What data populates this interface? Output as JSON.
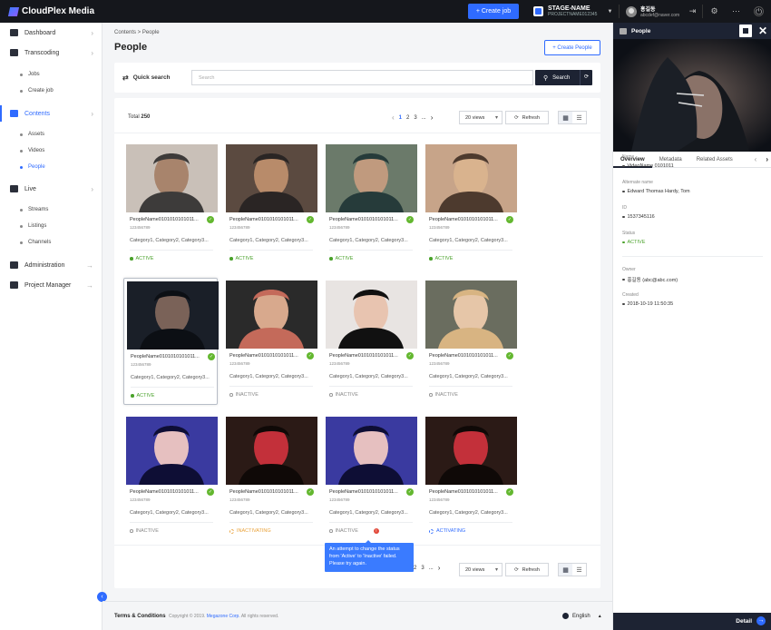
{
  "app": {
    "name": "CloudPlex Media",
    "create_job": "+ Create job"
  },
  "stage": {
    "name": "STAGE-NAME",
    "project": "PROJECTNAME012345"
  },
  "user": {
    "name": "홍길동",
    "email": "abcdef@naver.com"
  },
  "sidebar": {
    "dashboard": "Dashboard",
    "transcoding": "Transcoding",
    "jobs": "Jobs",
    "create_job": "Create job",
    "contents": "Contents",
    "assets": "Assets",
    "videos": "Videos",
    "people": "People",
    "live": "Live",
    "streams": "Streams",
    "listings": "Listings",
    "channels": "Channels",
    "administration": "Administration",
    "project_manager": "Project Manager"
  },
  "breadcrumb": "Contents > People",
  "page_title": "People",
  "create_people": "+ Create People",
  "quick_search": {
    "label": "Quick search",
    "placeholder": "Search",
    "button": "Search"
  },
  "list": {
    "total_label": "Total",
    "total": "250",
    "pages": [
      "1",
      "2",
      "3",
      "..."
    ],
    "per_page": "20 views",
    "refresh": "Refresh"
  },
  "cards": [
    {
      "name": "PeopleName0101010101011...",
      "code": "123456789",
      "cats": "Category1, Category2, Category3...",
      "status": "ACTIVE"
    },
    {
      "name": "PeopleName0101010101011...",
      "code": "123456789",
      "cats": "Category1, Category2, Category3...",
      "status": "ACTIVE"
    },
    {
      "name": "PeopleName0101010101011...",
      "code": "123456789",
      "cats": "Category1, Category2, Category3...",
      "status": "ACTIVE"
    },
    {
      "name": "PeopleName0101010101011...",
      "code": "123456789",
      "cats": "Category1, Category2, Category3...",
      "status": "ACTIVE"
    },
    {
      "name": "PeopleName0101010101011...",
      "code": "123456789",
      "cats": "Category1, Category2, Category3...",
      "status": "ACTIVE"
    },
    {
      "name": "PeopleName0101010101011...",
      "code": "123456789",
      "cats": "Category1, Category2, Category3...",
      "status": "INACTIVE"
    },
    {
      "name": "PeopleName0101010101011...",
      "code": "123456789",
      "cats": "Category1, Category2, Category3...",
      "status": "INACTIVE"
    },
    {
      "name": "PeopleName0101010101011...",
      "code": "123456789",
      "cats": "Category1, Category2, Category3...",
      "status": "INACTIVE"
    },
    {
      "name": "PeopleName0101010101011...",
      "code": "123456789",
      "cats": "Category1, Category2, Category3...",
      "status": "INACTIVE"
    },
    {
      "name": "PeopleName0101010101011...",
      "code": "123456789",
      "cats": "Category1, Category2, Category3...",
      "status": "INACTIVATING"
    },
    {
      "name": "PeopleName0101010101011...",
      "code": "123456789",
      "cats": "Category1, Category2, Category3...",
      "status": "INACTIVE"
    },
    {
      "name": "PeopleName0101010101011...",
      "code": "123456789",
      "cats": "Category1, Category2, Category3...",
      "status": "ACTIVATING"
    }
  ],
  "tooltip": "An attempt to change the status from 'Active' to 'Inactive' failed. Please try again.",
  "footer": {
    "terms": "Terms & Conditions",
    "copy_prefix": "Copyright © 2019.",
    "company": "Megazone Corp.",
    "copy_suffix": "All rights reserved.",
    "language": "English"
  },
  "right_panel": {
    "title": "People",
    "tabs": [
      "Overview",
      "Metadata",
      "Related Assets"
    ],
    "fields": [
      {
        "label": "Name",
        "value": "VideoName 0101011"
      },
      {
        "label": "Alternate name",
        "value": "Edward Thomas Hardy, Tom"
      },
      {
        "label": "ID",
        "value": "1537345116"
      },
      {
        "label": "Status",
        "value": "ACTIVE"
      },
      {
        "label": "Owner",
        "value": "홍길동 (abc@abc.com)"
      },
      {
        "label": "Created",
        "value": "2018-10-19 11:50:35"
      }
    ],
    "detail": "Detail"
  },
  "colors": {
    "accent": "#2f6bff",
    "dark": "#1d2333",
    "active": "#4aa22b",
    "inactivating": "#e9a23b",
    "error": "#e24a3b"
  }
}
